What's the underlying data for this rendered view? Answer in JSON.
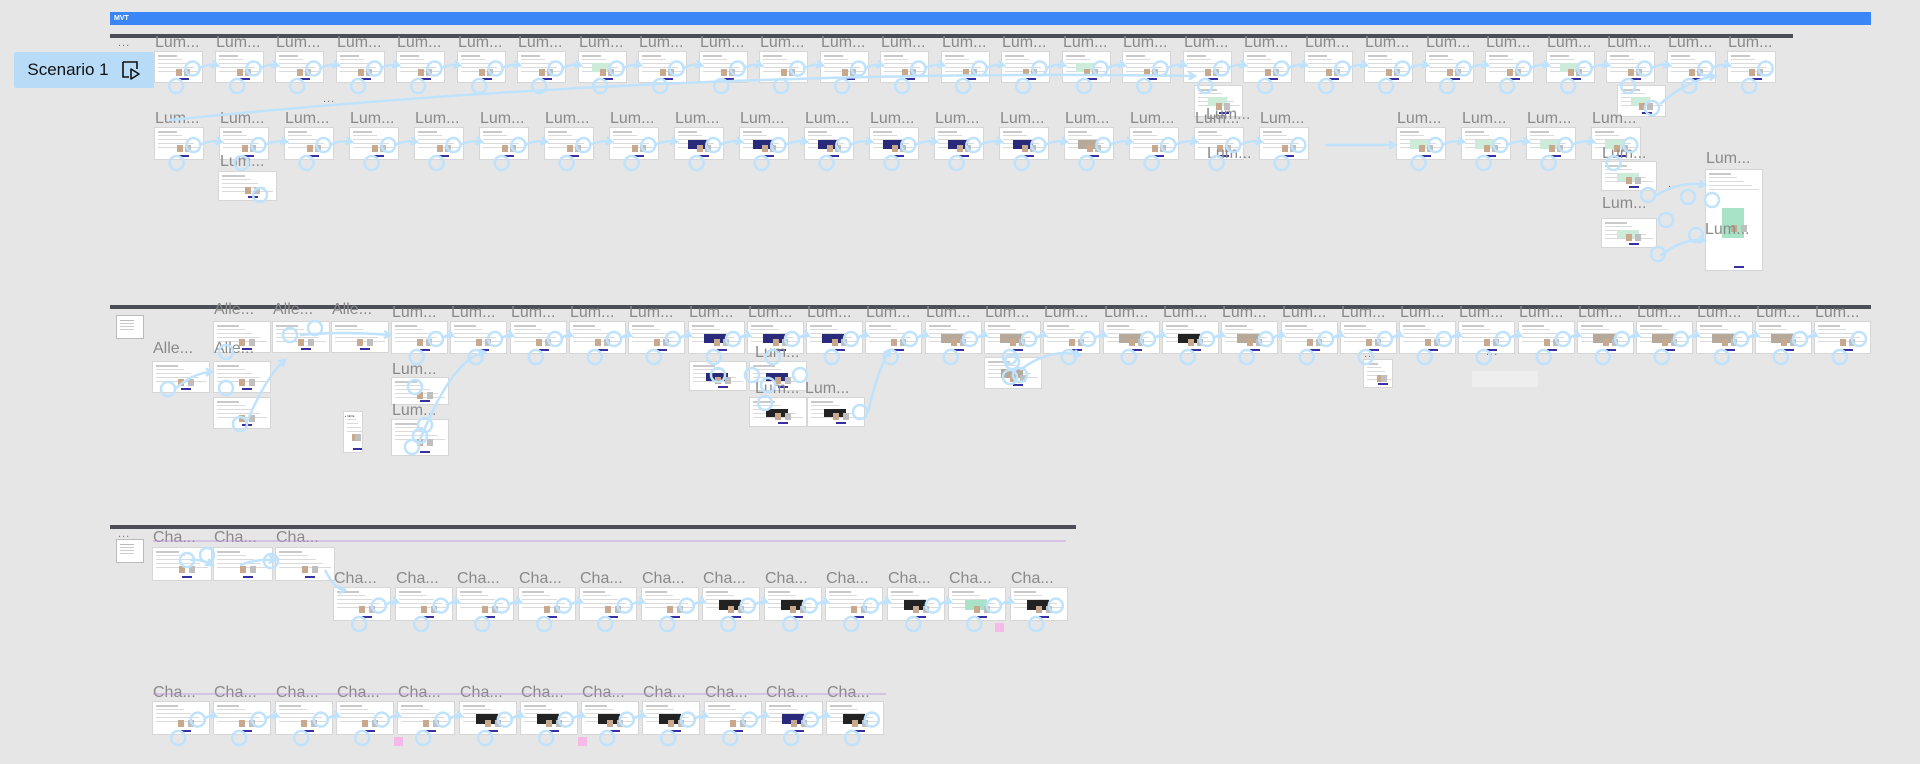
{
  "board": {
    "title": "MVT"
  },
  "scenario": {
    "label": "Scenario 1",
    "icon": "play-frame-icon"
  },
  "frame_labels": {
    "lum": "Lum...",
    "alle": "Alle...",
    "cha": "Cha..."
  },
  "ellipsis": "...",
  "colors": {
    "mvt_bar": "#3a86f7",
    "section_bar": "#4b4d57",
    "connector": "#bfe2fd",
    "scenario_chip": "#b8dcf8",
    "canvas": "#e6e6e6",
    "sticky_note": "#f6b9e8",
    "guide_line": "#b98ad9"
  }
}
